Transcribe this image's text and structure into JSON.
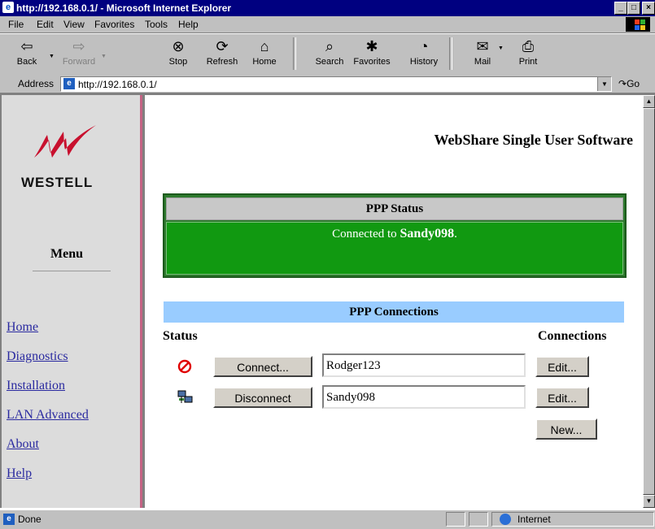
{
  "window": {
    "title": "http://192.168.0.1/ - Microsoft Internet Explorer"
  },
  "menubar": [
    "File",
    "Edit",
    "View",
    "Favorites",
    "Tools",
    "Help"
  ],
  "toolbar": {
    "back": "Back",
    "forward": "Forward",
    "stop": "Stop",
    "refresh": "Refresh",
    "home": "Home",
    "search": "Search",
    "favorites": "Favorites",
    "history": "History",
    "mail": "Mail",
    "print": "Print"
  },
  "address": {
    "label": "Address",
    "value": "http://192.168.0.1/",
    "go": "Go"
  },
  "sidebar": {
    "logo": "WESTELL",
    "menu_title": "Menu",
    "links": [
      "Home",
      "Diagnostics",
      "Installation",
      "LAN Advanced",
      "About",
      "Help"
    ]
  },
  "main": {
    "heading": "WebShare Single User Software",
    "ppp_status": {
      "title": "PPP Status",
      "message_prefix": "Connected to",
      "connection_name": "Sandy098",
      "message_suffix": "."
    },
    "ppp_connections": {
      "title": "PPP Connections",
      "status_header": "Status",
      "connections_header": "Connections",
      "rows": [
        {
          "status_icon": "disconnected-icon",
          "action": "Connect...",
          "name": "Rodger123",
          "edit": "Edit..."
        },
        {
          "status_icon": "connected-icon",
          "action": "Disconnect",
          "name": "Sandy098",
          "edit": "Edit..."
        }
      ],
      "new_label": "New..."
    }
  },
  "statusbar": {
    "status": "Done",
    "zone": "Internet"
  }
}
